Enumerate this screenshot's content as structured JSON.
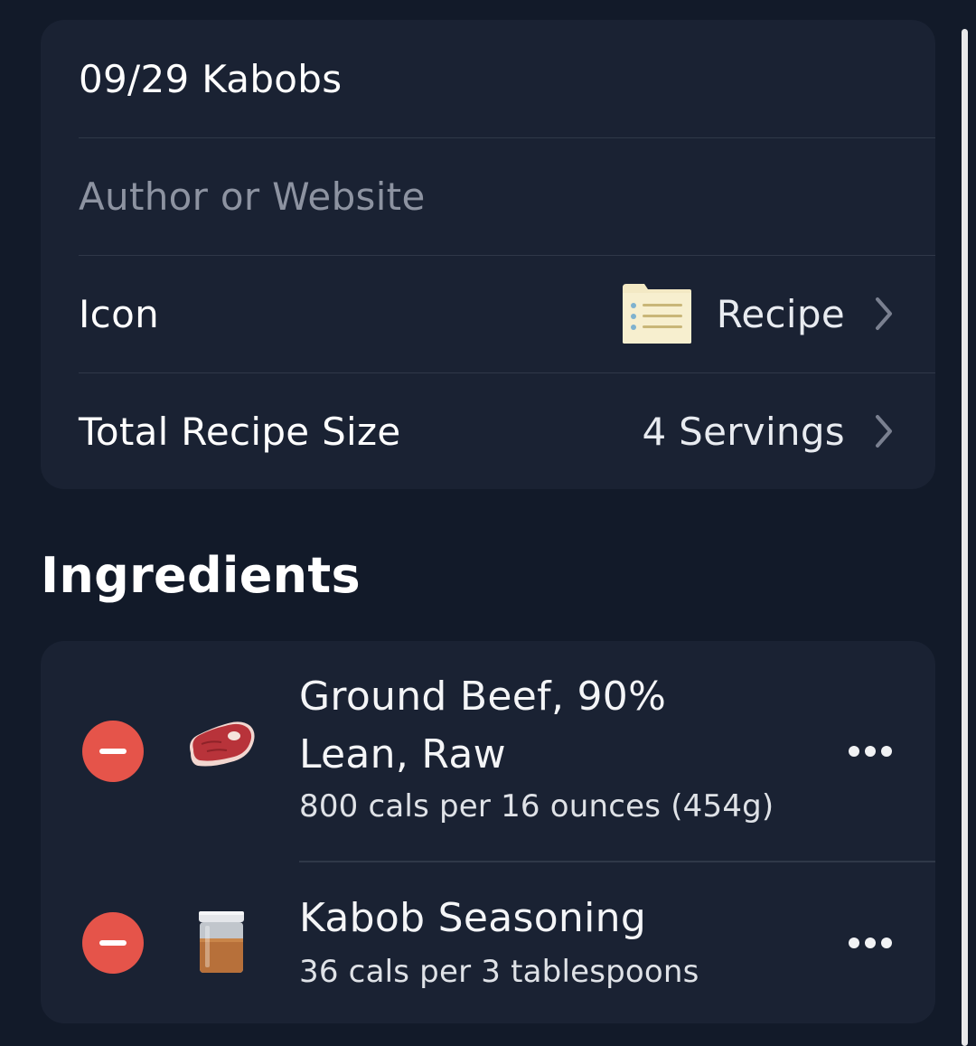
{
  "recipe": {
    "title": "09/29 Kabobs",
    "author_placeholder": "Author or Website",
    "icon_label": "Icon",
    "icon_value": "Recipe",
    "icon_name": "recipe-card-icon",
    "size_label": "Total Recipe Size",
    "size_value": "4 Servings"
  },
  "ingredients": {
    "title": "Ingredients",
    "items": [
      {
        "name_line1": "Ground Beef, 90%",
        "name_line2": "Lean, Raw",
        "detail": "800 cals per 16 ounces (454g)",
        "icon": "steak-icon"
      },
      {
        "name_line1": "Kabob Seasoning",
        "detail": "36 cals per 3 tablespoons",
        "icon": "spice-jar-icon"
      }
    ]
  },
  "colors": {
    "background": "#121a29",
    "card": "#1a2233",
    "remove": "#e5544a",
    "placeholder": "#8d93a1"
  }
}
